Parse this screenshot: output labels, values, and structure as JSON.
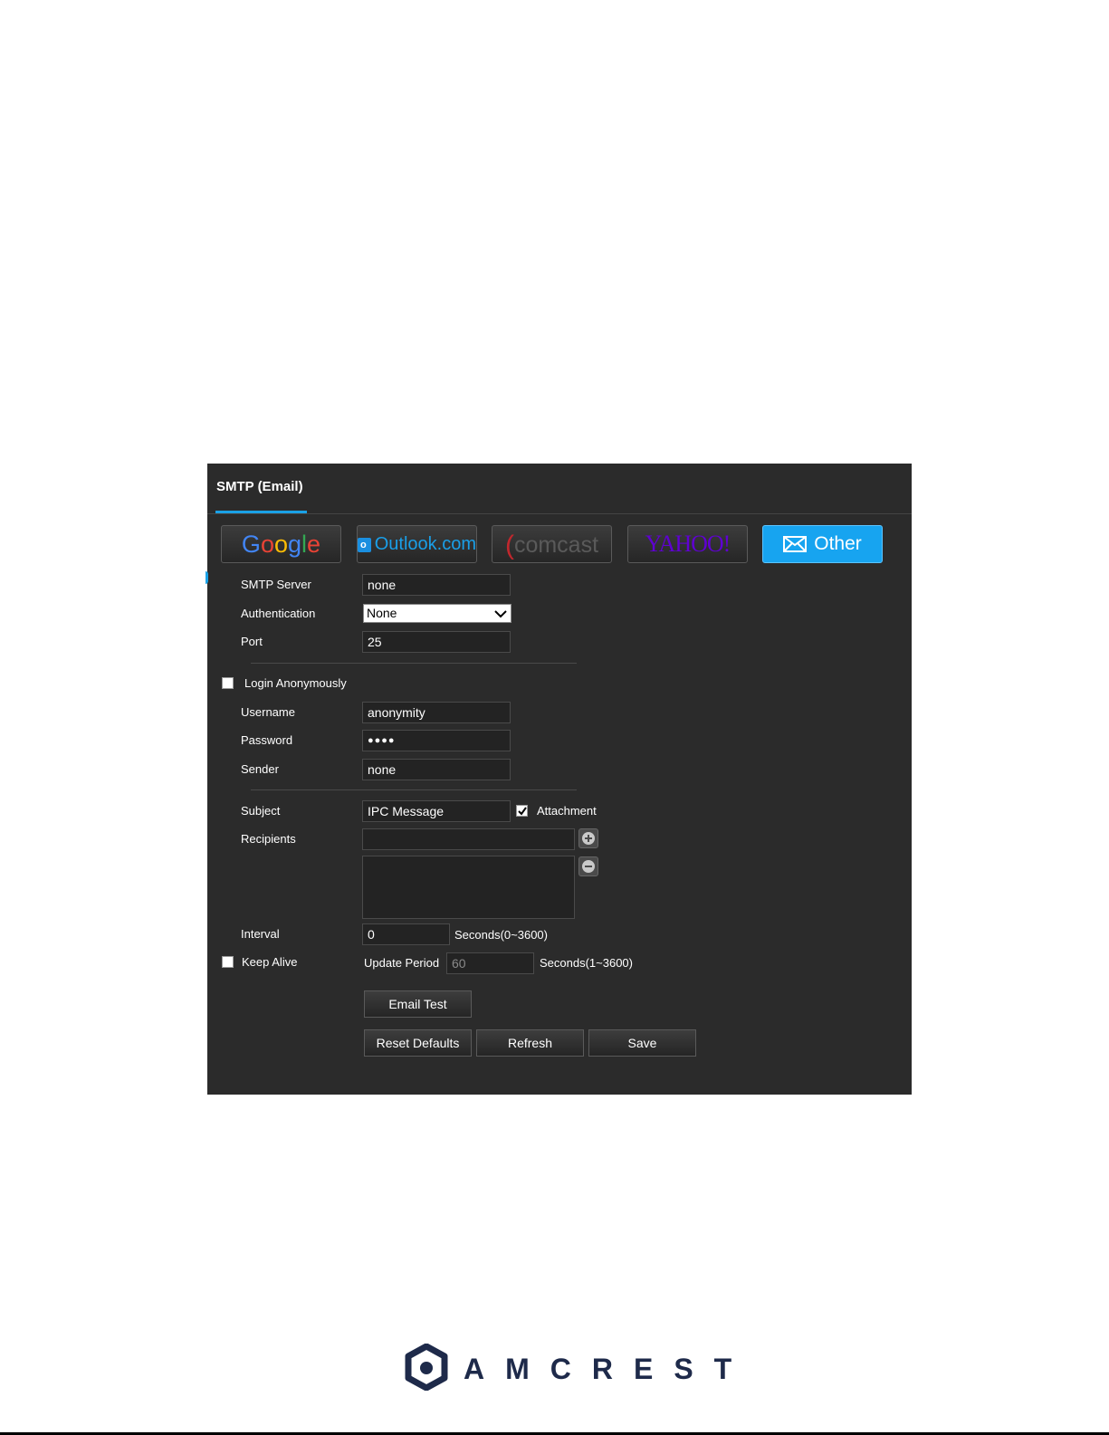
{
  "panel": {
    "title": "SMTP (Email)",
    "providers": [
      {
        "label": "Google"
      },
      {
        "label": "Outlook.com"
      },
      {
        "label": "Comcast"
      },
      {
        "label": "YAHOO!"
      },
      {
        "label": "Other"
      }
    ],
    "smtp_server_label": "SMTP Server",
    "smtp_server_value": "none",
    "authentication_label": "Authentication",
    "authentication_value": "None",
    "port_label": "Port",
    "port_value": "25",
    "login_anonymously_label": "Login Anonymously",
    "login_anonymously_checked": false,
    "username_label": "Username",
    "username_value": "anonymity",
    "password_label": "Password",
    "password_value": "●●●●",
    "sender_label": "Sender",
    "sender_value": "none",
    "subject_label": "Subject",
    "subject_value": "IPC Message",
    "attachment_label": "Attachment",
    "attachment_checked": true,
    "recipients_label": "Recipients",
    "interval_label": "Interval",
    "interval_value": "0",
    "interval_unit": "Seconds(0~3600)",
    "keep_alive_label": "Keep Alive",
    "keep_alive_checked": false,
    "update_period_label": "Update Period",
    "update_period_value": "60",
    "update_period_unit": "Seconds(1~3600)",
    "email_test_label": "Email Test",
    "reset_defaults_label": "Reset Defaults",
    "refresh_label": "Refresh",
    "save_label": "Save"
  },
  "footer": {
    "brand": "AMCREST"
  },
  "colors": {
    "panel_bg": "#2b2b2b",
    "accent": "#1aa1e6",
    "brand": "#1e2a4a"
  }
}
